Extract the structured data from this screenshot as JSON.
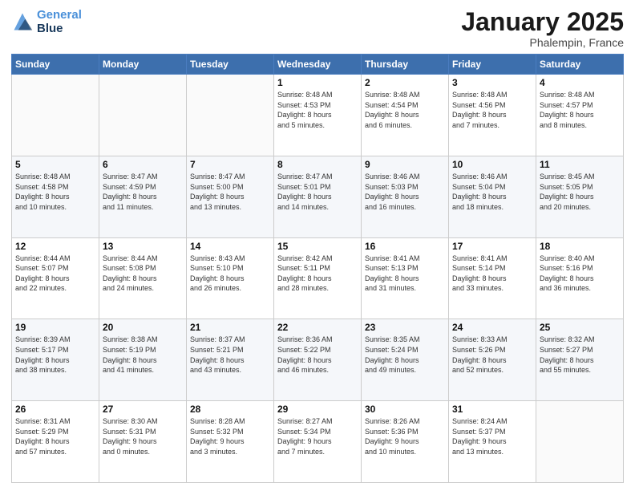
{
  "header": {
    "logo_line1": "General",
    "logo_line2": "Blue",
    "month": "January 2025",
    "location": "Phalempin, France"
  },
  "days_of_week": [
    "Sunday",
    "Monday",
    "Tuesday",
    "Wednesday",
    "Thursday",
    "Friday",
    "Saturday"
  ],
  "weeks": [
    [
      {
        "num": "",
        "info": ""
      },
      {
        "num": "",
        "info": ""
      },
      {
        "num": "",
        "info": ""
      },
      {
        "num": "1",
        "info": "Sunrise: 8:48 AM\nSunset: 4:53 PM\nDaylight: 8 hours\nand 5 minutes."
      },
      {
        "num": "2",
        "info": "Sunrise: 8:48 AM\nSunset: 4:54 PM\nDaylight: 8 hours\nand 6 minutes."
      },
      {
        "num": "3",
        "info": "Sunrise: 8:48 AM\nSunset: 4:56 PM\nDaylight: 8 hours\nand 7 minutes."
      },
      {
        "num": "4",
        "info": "Sunrise: 8:48 AM\nSunset: 4:57 PM\nDaylight: 8 hours\nand 8 minutes."
      }
    ],
    [
      {
        "num": "5",
        "info": "Sunrise: 8:48 AM\nSunset: 4:58 PM\nDaylight: 8 hours\nand 10 minutes."
      },
      {
        "num": "6",
        "info": "Sunrise: 8:47 AM\nSunset: 4:59 PM\nDaylight: 8 hours\nand 11 minutes."
      },
      {
        "num": "7",
        "info": "Sunrise: 8:47 AM\nSunset: 5:00 PM\nDaylight: 8 hours\nand 13 minutes."
      },
      {
        "num": "8",
        "info": "Sunrise: 8:47 AM\nSunset: 5:01 PM\nDaylight: 8 hours\nand 14 minutes."
      },
      {
        "num": "9",
        "info": "Sunrise: 8:46 AM\nSunset: 5:03 PM\nDaylight: 8 hours\nand 16 minutes."
      },
      {
        "num": "10",
        "info": "Sunrise: 8:46 AM\nSunset: 5:04 PM\nDaylight: 8 hours\nand 18 minutes."
      },
      {
        "num": "11",
        "info": "Sunrise: 8:45 AM\nSunset: 5:05 PM\nDaylight: 8 hours\nand 20 minutes."
      }
    ],
    [
      {
        "num": "12",
        "info": "Sunrise: 8:44 AM\nSunset: 5:07 PM\nDaylight: 8 hours\nand 22 minutes."
      },
      {
        "num": "13",
        "info": "Sunrise: 8:44 AM\nSunset: 5:08 PM\nDaylight: 8 hours\nand 24 minutes."
      },
      {
        "num": "14",
        "info": "Sunrise: 8:43 AM\nSunset: 5:10 PM\nDaylight: 8 hours\nand 26 minutes."
      },
      {
        "num": "15",
        "info": "Sunrise: 8:42 AM\nSunset: 5:11 PM\nDaylight: 8 hours\nand 28 minutes."
      },
      {
        "num": "16",
        "info": "Sunrise: 8:41 AM\nSunset: 5:13 PM\nDaylight: 8 hours\nand 31 minutes."
      },
      {
        "num": "17",
        "info": "Sunrise: 8:41 AM\nSunset: 5:14 PM\nDaylight: 8 hours\nand 33 minutes."
      },
      {
        "num": "18",
        "info": "Sunrise: 8:40 AM\nSunset: 5:16 PM\nDaylight: 8 hours\nand 36 minutes."
      }
    ],
    [
      {
        "num": "19",
        "info": "Sunrise: 8:39 AM\nSunset: 5:17 PM\nDaylight: 8 hours\nand 38 minutes."
      },
      {
        "num": "20",
        "info": "Sunrise: 8:38 AM\nSunset: 5:19 PM\nDaylight: 8 hours\nand 41 minutes."
      },
      {
        "num": "21",
        "info": "Sunrise: 8:37 AM\nSunset: 5:21 PM\nDaylight: 8 hours\nand 43 minutes."
      },
      {
        "num": "22",
        "info": "Sunrise: 8:36 AM\nSunset: 5:22 PM\nDaylight: 8 hours\nand 46 minutes."
      },
      {
        "num": "23",
        "info": "Sunrise: 8:35 AM\nSunset: 5:24 PM\nDaylight: 8 hours\nand 49 minutes."
      },
      {
        "num": "24",
        "info": "Sunrise: 8:33 AM\nSunset: 5:26 PM\nDaylight: 8 hours\nand 52 minutes."
      },
      {
        "num": "25",
        "info": "Sunrise: 8:32 AM\nSunset: 5:27 PM\nDaylight: 8 hours\nand 55 minutes."
      }
    ],
    [
      {
        "num": "26",
        "info": "Sunrise: 8:31 AM\nSunset: 5:29 PM\nDaylight: 8 hours\nand 57 minutes."
      },
      {
        "num": "27",
        "info": "Sunrise: 8:30 AM\nSunset: 5:31 PM\nDaylight: 9 hours\nand 0 minutes."
      },
      {
        "num": "28",
        "info": "Sunrise: 8:28 AM\nSunset: 5:32 PM\nDaylight: 9 hours\nand 3 minutes."
      },
      {
        "num": "29",
        "info": "Sunrise: 8:27 AM\nSunset: 5:34 PM\nDaylight: 9 hours\nand 7 minutes."
      },
      {
        "num": "30",
        "info": "Sunrise: 8:26 AM\nSunset: 5:36 PM\nDaylight: 9 hours\nand 10 minutes."
      },
      {
        "num": "31",
        "info": "Sunrise: 8:24 AM\nSunset: 5:37 PM\nDaylight: 9 hours\nand 13 minutes."
      },
      {
        "num": "",
        "info": ""
      }
    ]
  ]
}
